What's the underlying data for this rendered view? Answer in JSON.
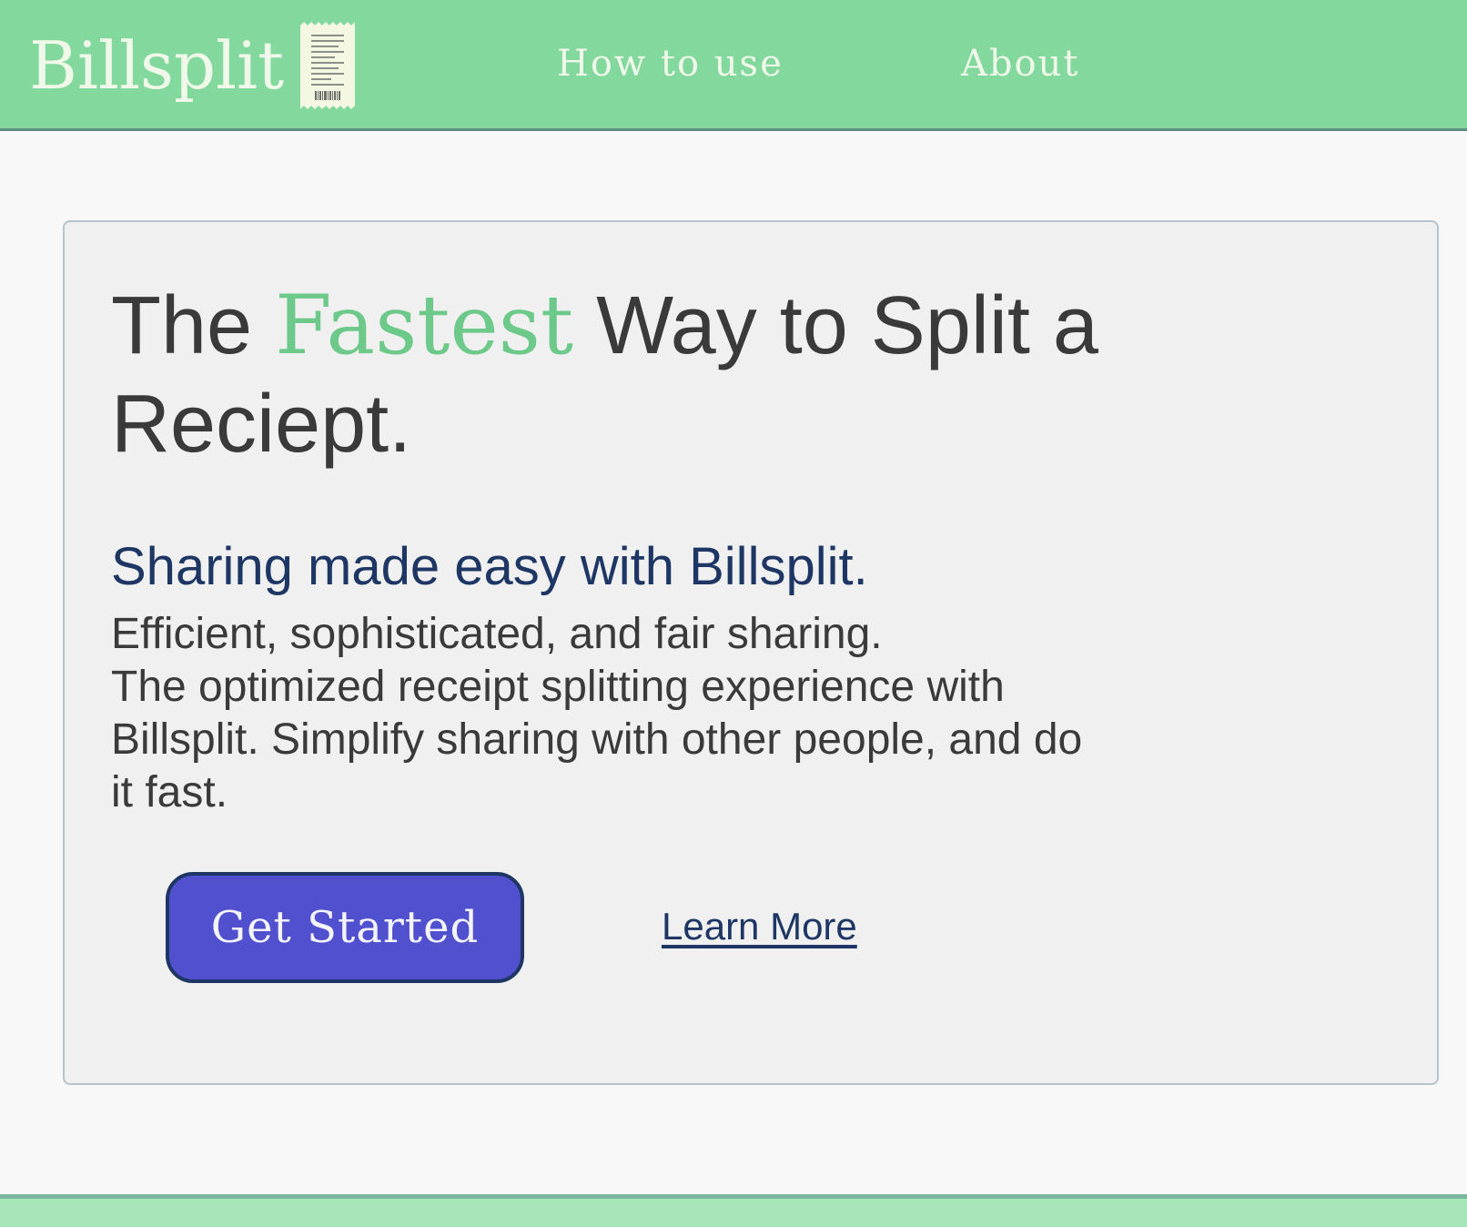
{
  "header": {
    "brand": "Billsplit",
    "brand_icon": "receipt-icon",
    "nav": {
      "how_to_use": "How to use",
      "about": "About"
    },
    "background_color": "#82d89d"
  },
  "hero": {
    "headline_before": "The ",
    "headline_accent": "Fastest",
    "headline_after": " Way to Split a Reciept.",
    "subheading": "Sharing made easy with Billsplit.",
    "body_line_1": "Efficient, sophisticated, and fair sharing.",
    "body_line_2": "The optimized receipt splitting experience with Billsplit. Simplify sharing with other people, and do it fast.",
    "cta_primary": "Get Started",
    "cta_secondary": "Learn More",
    "accent_color": "#6dc98a",
    "button_color": "#5150cf"
  }
}
